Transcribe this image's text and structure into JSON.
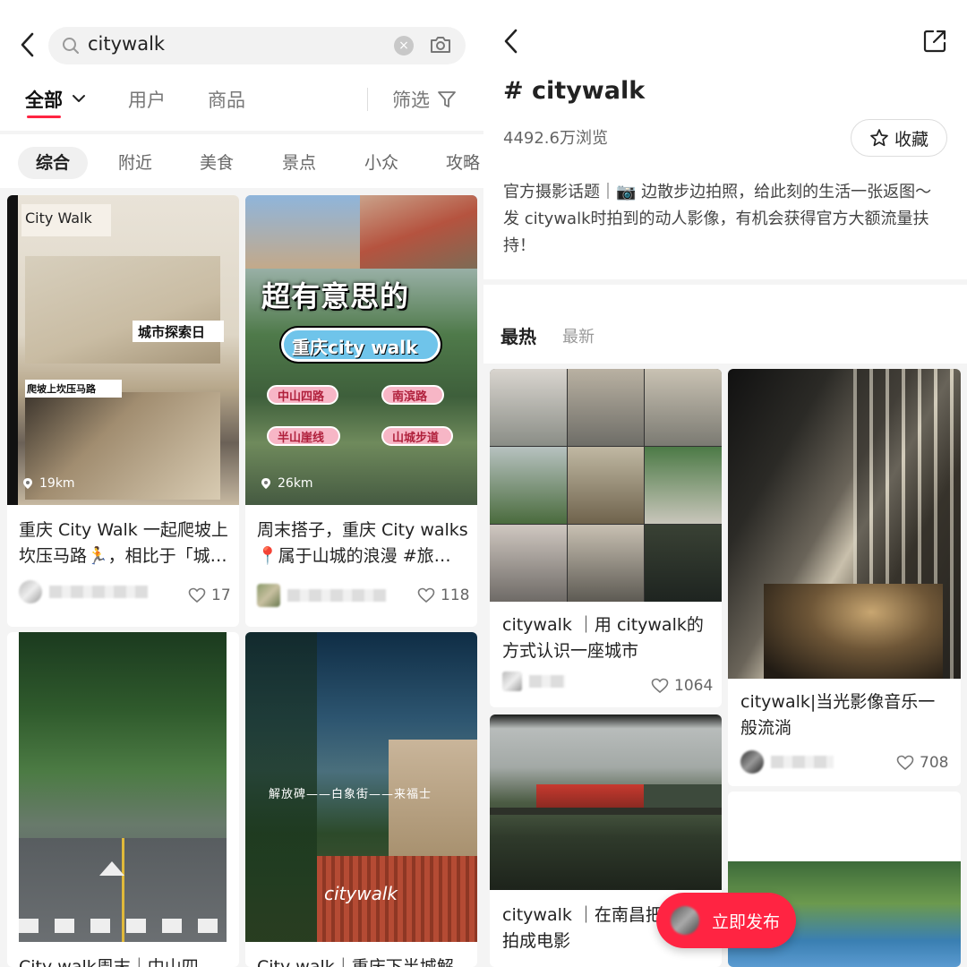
{
  "search": {
    "query": "citywalk",
    "main_tabs": [
      "全部",
      "用户",
      "商品"
    ],
    "filter_label": "筛选",
    "chips": [
      "综合",
      "附近",
      "美食",
      "景点",
      "小众",
      "攻略"
    ]
  },
  "left_cards": [
    {
      "title": "重庆 City Walk 一起爬坡上坎压马路🏃，相比于「城…",
      "distance": "19km",
      "likes": "17",
      "overlay_texts": [
        "City Walk",
        "城市探索日",
        "爬坡上坎压马路"
      ]
    },
    {
      "title": "周末搭子，重庆 City walks📍属于山城的浪漫 #旅…",
      "distance": "26km",
      "likes": "118",
      "overlay_texts": [
        "超有意思的",
        "重庆city walk",
        "中山四路",
        "南滨路",
        "半山崖线",
        "山城步道"
      ]
    },
    {
      "title": "City walk周末｜中山四",
      "overlay_texts": []
    },
    {
      "title": "City walk｜重庆下半城解",
      "overlay_texts": [
        "解放碑——白象街——来福士",
        "citywalk"
      ]
    }
  ],
  "topic": {
    "title": "# citywalk",
    "views": "4492.6万浏览",
    "favorite_label": "收藏",
    "description": "官方摄影话题｜📷 边散步边拍照，给此刻的生活一张返图～ 发 citywalk时拍到的动人影像，有机会获得官方大额流量扶持！",
    "tabs": [
      "最热",
      "最新"
    ]
  },
  "right_cards": [
    {
      "title": "citywalk ｜用 citywalk的方式认识一座城市",
      "likes": "1064"
    },
    {
      "title": "citywalk|当光影像音乐一般流淌",
      "likes": "708"
    },
    {
      "title": "citywalk ｜在南昌把日常拍成电影"
    }
  ],
  "fab": {
    "label": "立即发布"
  }
}
